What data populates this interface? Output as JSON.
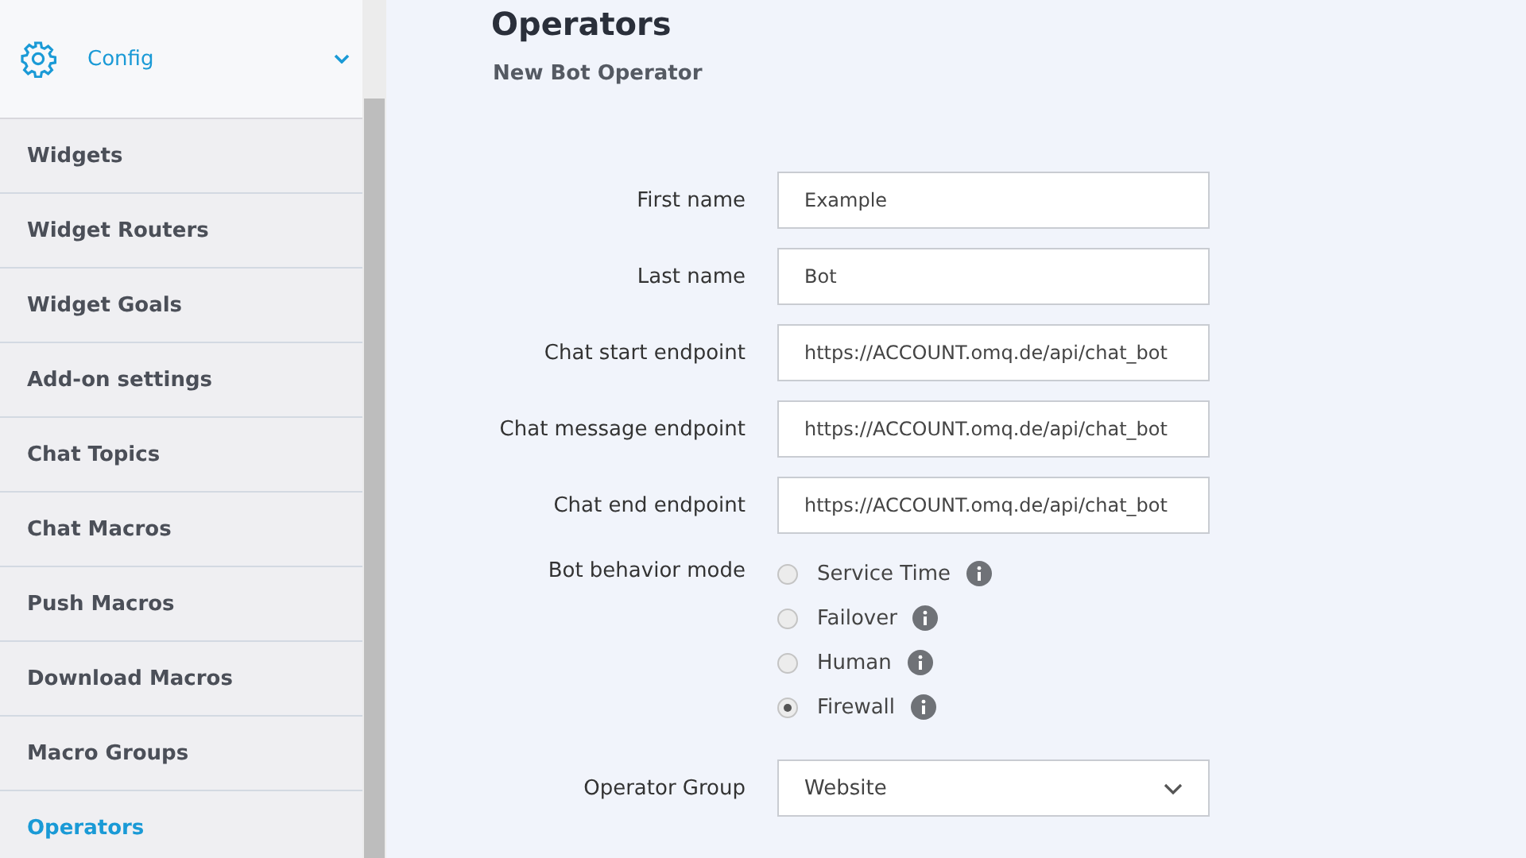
{
  "sidebar": {
    "header": {
      "label": "Config",
      "expanded": true
    },
    "items": [
      {
        "label": "Widgets",
        "selected": false
      },
      {
        "label": "Widget Routers",
        "selected": false
      },
      {
        "label": "Widget Goals",
        "selected": false
      },
      {
        "label": "Add-on settings",
        "selected": false
      },
      {
        "label": "Chat Topics",
        "selected": false
      },
      {
        "label": "Chat Macros",
        "selected": false
      },
      {
        "label": "Push Macros",
        "selected": false
      },
      {
        "label": "Download Macros",
        "selected": false
      },
      {
        "label": "Macro Groups",
        "selected": false
      },
      {
        "label": "Operators",
        "selected": true
      }
    ]
  },
  "page": {
    "title": "Operators",
    "subtitle": "New Bot Operator"
  },
  "form": {
    "fields": [
      {
        "label": "First name",
        "value": "Example"
      },
      {
        "label": "Last name",
        "value": "Bot"
      },
      {
        "label": "Chat start endpoint",
        "value": "https://ACCOUNT.omq.de/api/chat_bot"
      },
      {
        "label": "Chat message endpoint",
        "value": "https://ACCOUNT.omq.de/api/chat_bot"
      },
      {
        "label": "Chat end endpoint",
        "value": "https://ACCOUNT.omq.de/api/chat_bot"
      }
    ],
    "mode": {
      "label": "Bot behavior mode",
      "options": [
        {
          "label": "Service Time",
          "selected": false
        },
        {
          "label": "Failover",
          "selected": false
        },
        {
          "label": "Human",
          "selected": false
        },
        {
          "label": "Firewall",
          "selected": true
        }
      ]
    },
    "group": {
      "label": "Operator Group",
      "value": "Website"
    }
  }
}
